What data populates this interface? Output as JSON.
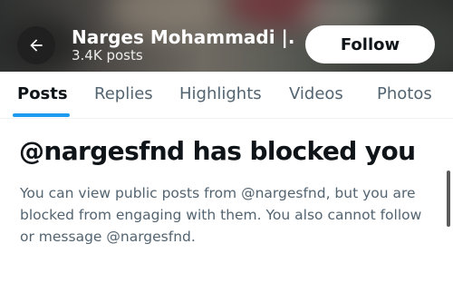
{
  "header": {
    "profile_name": "Narges Mohammadi |...",
    "post_count": "3.4K posts",
    "follow_label": "Follow",
    "back_icon": "arrow-left-icon"
  },
  "tabs": [
    {
      "label": "Posts",
      "active": true
    },
    {
      "label": "Replies",
      "active": false
    },
    {
      "label": "Highlights",
      "active": false
    },
    {
      "label": "Videos",
      "active": false
    },
    {
      "label": "Photos",
      "active": false
    }
  ],
  "blocked": {
    "title": "@nargesfnd has blocked you",
    "description": "You can view public posts from @nargesfnd, but you are blocked from engaging with them. You also cannot follow or message @nargesfnd."
  },
  "colors": {
    "accent": "#1d9bf0",
    "text_primary": "#0f1419",
    "text_secondary": "#536471"
  }
}
